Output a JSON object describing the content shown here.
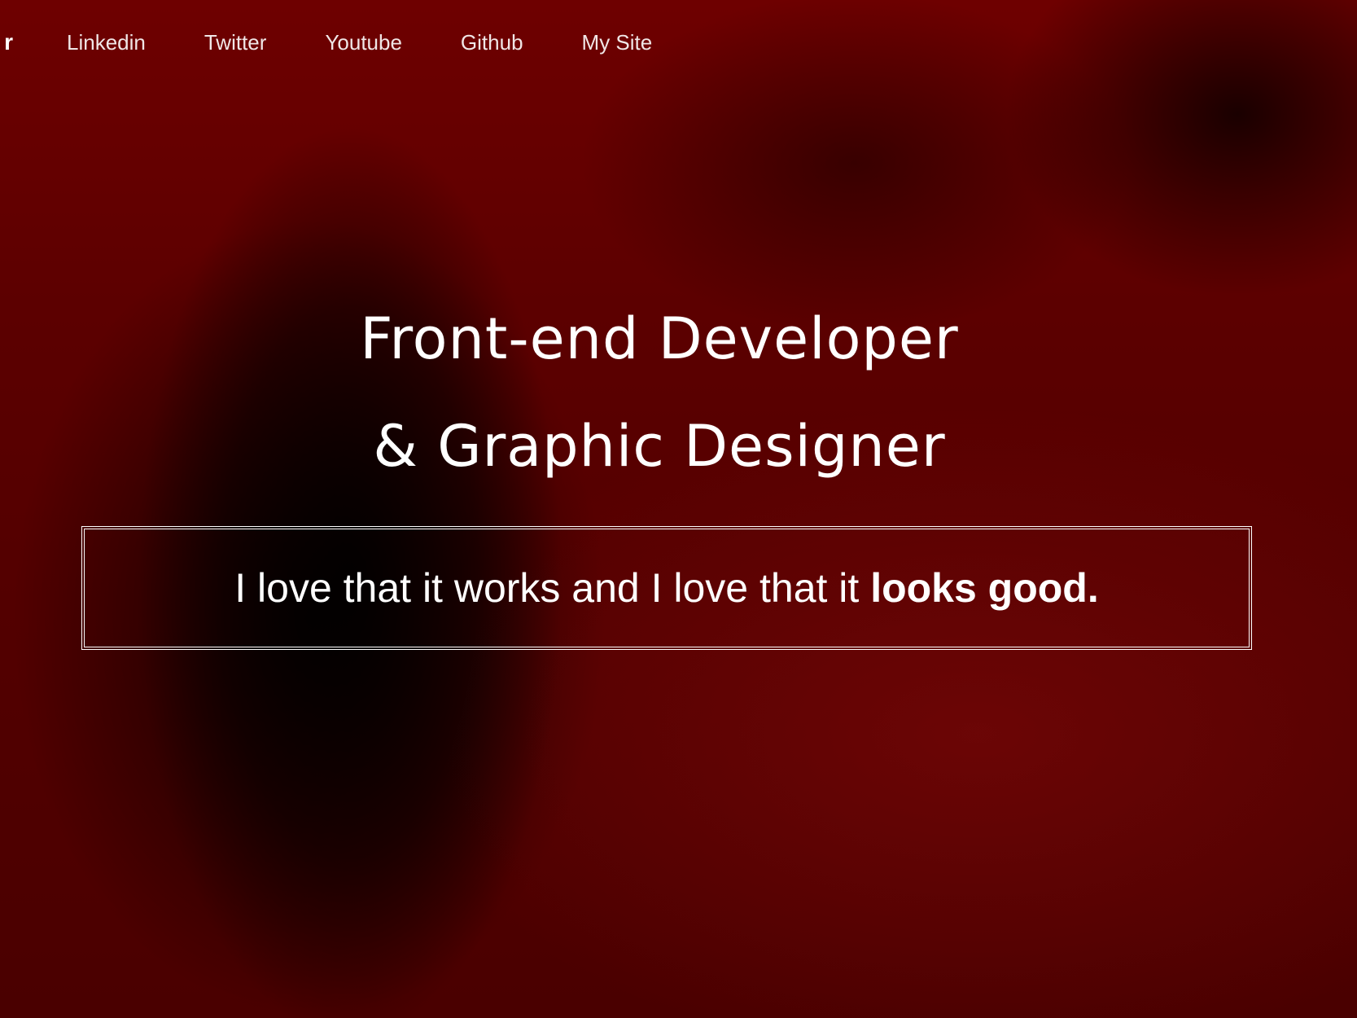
{
  "nav": {
    "brand_fragment": "r",
    "links": [
      {
        "label": "Linkedin"
      },
      {
        "label": "Twitter"
      },
      {
        "label": "Youtube"
      },
      {
        "label": "Github"
      },
      {
        "label": "My Site"
      }
    ]
  },
  "hero": {
    "headline_line1": "Front-end Developer",
    "headline_line2": "& Graphic Designer",
    "tagline_regular": "I love that it works and I love that it ",
    "tagline_bold": "looks good."
  },
  "colors": {
    "background_tint": "#6e0000",
    "text": "#ffffff"
  }
}
